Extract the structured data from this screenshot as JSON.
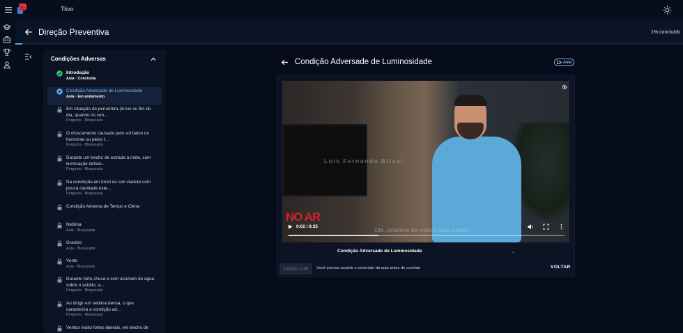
{
  "app": {
    "name": "Tiivo"
  },
  "course": {
    "title": "Direção Preventiva",
    "progress_label": "1% concluído",
    "progress_fraction": 0.01
  },
  "sidebar": {
    "section_title": "Condições Adversas",
    "items": [
      {
        "title": "Introdução",
        "subtitle": "Aula · Concluída",
        "status": "done",
        "icon": "check-circle-icon"
      },
      {
        "title": "Condição Adversade de Luminosidade",
        "subtitle": "Aula · Em andamento",
        "status": "active",
        "icon": "play-circle-icon"
      },
      {
        "title": "Em situação de penumbra (início ou fim do dia, quando os con...",
        "subtitle": "Pergunta · Bloqueada",
        "status": "locked",
        "icon": "lock-icon"
      },
      {
        "title": "O ofuscamento causado pelo sol baixo no horizonte ou pelos f...",
        "subtitle": "Pergunta · Bloqueada",
        "status": "locked",
        "icon": "lock-icon"
      },
      {
        "title": "Durante um trecho de estrada à noite, com iluminação deficie...",
        "subtitle": "Pergunta · Bloqueada",
        "status": "locked",
        "icon": "lock-icon"
      },
      {
        "title": "Na condução em túnel ou sob viaduto com pouca claridade exte...",
        "subtitle": "Pergunta · Bloqueada",
        "status": "locked",
        "icon": "lock-icon"
      },
      {
        "title": "Condição Adversa de Tempo e Clima",
        "subtitle": "",
        "status": "locked",
        "icon": "lock-icon"
      },
      {
        "title": "Neblina",
        "subtitle": "Aula · Bloqueada",
        "status": "locked",
        "icon": "lock-icon"
      },
      {
        "title": "Granizo",
        "subtitle": "Aula · Bloqueada",
        "status": "locked",
        "icon": "lock-icon"
      },
      {
        "title": "Vento",
        "subtitle": "Aula · Bloqueada",
        "status": "locked",
        "icon": "lock-icon"
      },
      {
        "title": "Durante forte chuva e com acúmulo de água sobre o asfalto, a...",
        "subtitle": "Pergunta · Bloqueada",
        "status": "locked",
        "icon": "lock-icon"
      },
      {
        "title": "Ao dirigir em neblina densa, o que caracteriza a condição ad...",
        "subtitle": "Pergunta · Bloqueada",
        "status": "locked",
        "icon": "lock-icon"
      },
      {
        "title": "Ventos muito fortes laterais, em trecho de",
        "subtitle": "",
        "status": "locked",
        "icon": "lock-icon"
      }
    ]
  },
  "lesson": {
    "title": "Condição Adversade de Luminosidade",
    "badge": "Aula",
    "video_label": "Condição Adversade de Luminosidade",
    "caret": "⌄",
    "conclude_button": "CONCLUIR",
    "hint": "Você precisa assistir o conteúdo da aula antes de concluir",
    "back_button": "VOLTAR"
  },
  "video": {
    "time": "0:02 / 8:35",
    "watermark": "Luis Fernando Bitsal",
    "logo_text": "NO AR",
    "caption": "Olá, estamos de volta e hoje vamos",
    "played_fraction": 0.004,
    "buffered_fraction": 0.33
  },
  "colors": {
    "accent": "#5aa9e6",
    "background": "#050b18",
    "panel": "#0b1325",
    "done": "#2ecc71",
    "live_red": "#d4202a"
  }
}
